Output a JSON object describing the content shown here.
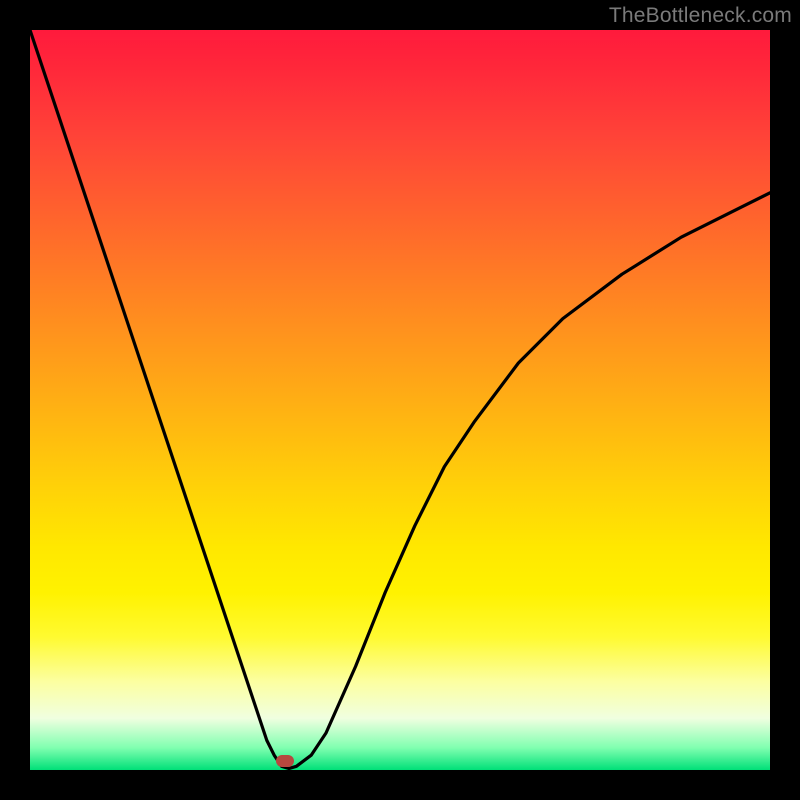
{
  "watermark": "TheBottleneck.com",
  "chart_data": {
    "type": "line",
    "title": "",
    "xlabel": "",
    "ylabel": "",
    "xlim": [
      0,
      100
    ],
    "ylim": [
      0,
      100
    ],
    "series": [
      {
        "name": "curve",
        "x": [
          0,
          4,
          8,
          12,
          16,
          20,
          24,
          28,
          30,
          32,
          33,
          34,
          35,
          36,
          38,
          40,
          44,
          48,
          52,
          56,
          60,
          66,
          72,
          80,
          88,
          96,
          100
        ],
        "y": [
          100,
          88,
          76,
          64,
          52,
          40,
          28,
          16,
          10,
          4,
          2,
          0.5,
          0.2,
          0.5,
          2,
          5,
          14,
          24,
          33,
          41,
          47,
          55,
          61,
          67,
          72,
          76,
          78
        ]
      }
    ],
    "marker": {
      "x": 34.5,
      "y": 1.2,
      "color": "#b6483f"
    },
    "gradient_stops": [
      {
        "pos": 0,
        "color": "#ff1a3c"
      },
      {
        "pos": 50,
        "color": "#ffd000"
      },
      {
        "pos": 100,
        "color": "#00e078"
      }
    ]
  }
}
